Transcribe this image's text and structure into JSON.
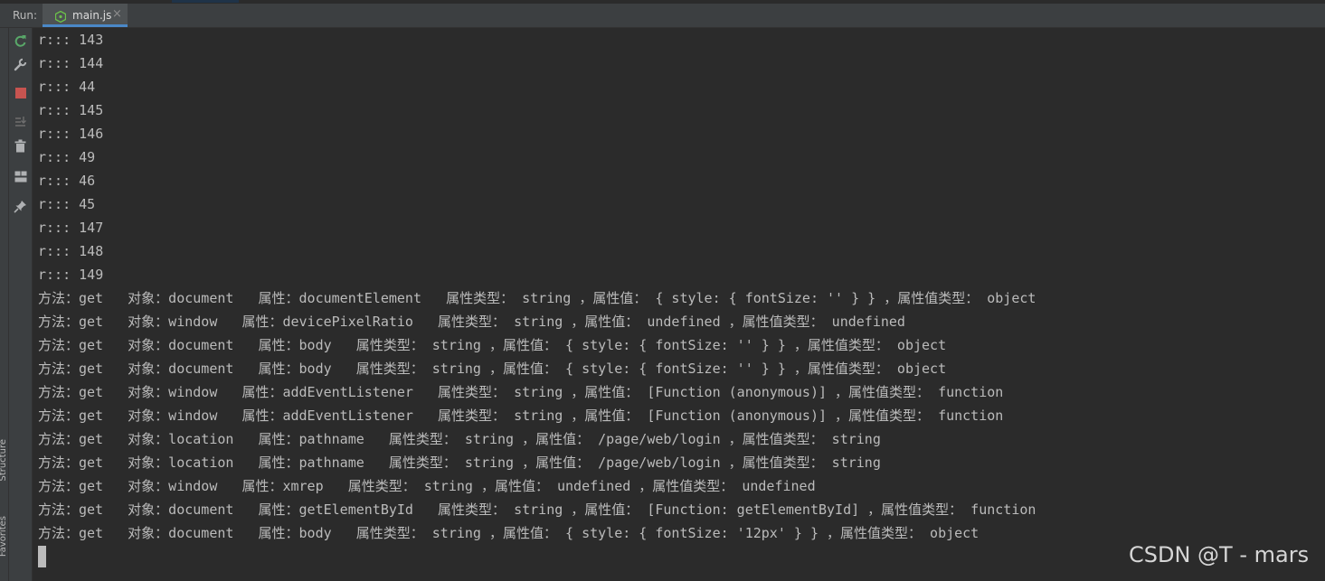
{
  "run_panel": {
    "label": "Run:",
    "tab": {
      "label": "main.js",
      "close": "×",
      "icon": "nodejs-file-icon"
    }
  },
  "side_labels": [
    "Structure",
    "Favorites"
  ],
  "toolbar": [
    {
      "name": "rerun-icon",
      "color": "#59a869"
    },
    {
      "name": "wrench-icon",
      "color": "#afb1b3"
    },
    {
      "name": "stop-icon",
      "color": "#c75450"
    },
    {
      "name": "sort-down-icon",
      "color": "#6e6e6e"
    },
    {
      "name": "trash-icon",
      "color": "#afb1b3"
    },
    {
      "name": "layout-icon",
      "color": "#afb1b3"
    },
    {
      "name": "pin-icon",
      "color": "#afb1b3"
    }
  ],
  "console": {
    "lines": [
      "r::: 143",
      "r::: 144",
      "r::: 44",
      "r::: 145",
      "r::: 146",
      "r::: 49",
      "r::: 46",
      "r::: 45",
      "r::: 147",
      "r::: 148",
      "r::: 149",
      "方法：get   对象：document   属性：documentElement   属性类型： string ，属性值： { style: { fontSize: '' } } ，属性值类型： object",
      "方法：get   对象：window   属性：devicePixelRatio   属性类型： string ，属性值： undefined ，属性值类型： undefined",
      "方法：get   对象：document   属性：body   属性类型： string ，属性值： { style: { fontSize: '' } } ，属性值类型： object",
      "方法：get   对象：document   属性：body   属性类型： string ，属性值： { style: { fontSize: '' } } ，属性值类型： object",
      "方法：get   对象：window   属性：addEventListener   属性类型： string ，属性值： [Function (anonymous)] ，属性值类型： function",
      "方法：get   对象：window   属性：addEventListener   属性类型： string ，属性值： [Function (anonymous)] ，属性值类型： function",
      "方法：get   对象：location   属性：pathname   属性类型： string ，属性值： /page/web/login ，属性值类型： string",
      "方法：get   对象：location   属性：pathname   属性类型： string ，属性值： /page/web/login ，属性值类型： string",
      "方法：get   对象：window   属性：xmrep   属性类型： string ，属性值： undefined ，属性值类型： undefined",
      "方法：get   对象：document   属性：getElementById   属性类型： string ，属性值： [Function: getElementById] ，属性值类型： function",
      "方法：get   对象：document   属性：body   属性类型： string ，属性值： { style: { fontSize: '12px' } } ，属性值类型： object"
    ]
  },
  "watermark": "CSDN @T - mars"
}
